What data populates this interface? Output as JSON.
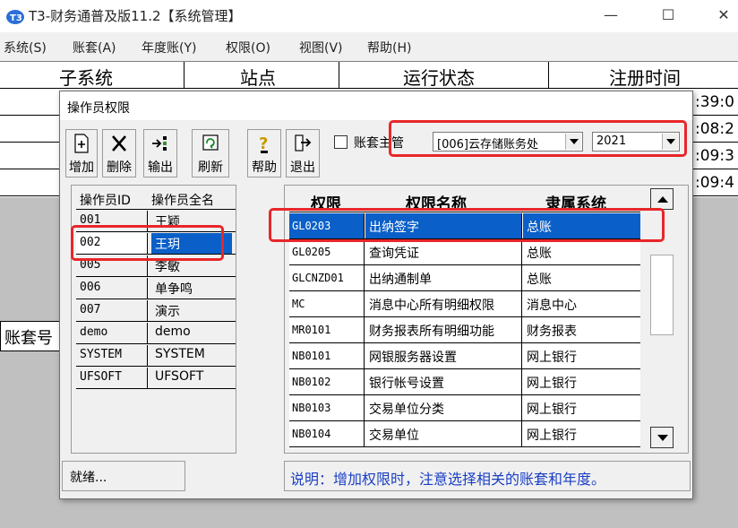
{
  "window": {
    "title": "T3-财务通普及版11.2【系统管理】",
    "minimize": "—",
    "maximize": "☐",
    "close": "✕"
  },
  "menu": [
    "系统(S)",
    "账套(A)",
    "年度账(Y)",
    "权限(O)",
    "视图(V)",
    "帮助(H)"
  ],
  "main_table": {
    "columns": [
      "子系统",
      "站点",
      "运行状态",
      "注册时间"
    ],
    "times": [
      ":39:0",
      ":08:2",
      ":09:3",
      ":09:4"
    ],
    "lower_label": "账套号"
  },
  "dialog": {
    "title": "操作员权限",
    "toolbar": [
      "增加",
      "删除",
      "输出",
      "刷新",
      "帮助",
      "退出"
    ],
    "supervisor_label": "账套主管",
    "account_combo": "[006]云存储账务处",
    "year_combo": "2021",
    "operator_columns": [
      "操作员ID",
      "操作员全名"
    ],
    "operators": [
      {
        "id": "001",
        "name": "王颖"
      },
      {
        "id": "002",
        "name": "王玥"
      },
      {
        "id": "005",
        "name": "李敏"
      },
      {
        "id": "006",
        "name": "单争鸣"
      },
      {
        "id": "007",
        "name": "演示"
      },
      {
        "id": "demo",
        "name": "demo"
      },
      {
        "id": "SYSTEM",
        "name": "SYSTEM"
      },
      {
        "id": "UFSOFT",
        "name": "UFSOFT"
      }
    ],
    "selected_operator": "002",
    "perm_columns": [
      "权限",
      "权限名称",
      "隶属系统"
    ],
    "permissions": [
      {
        "code": "GL0203",
        "name": "出纳签字",
        "system": "总账"
      },
      {
        "code": "GL0205",
        "name": "查询凭证",
        "system": "总账"
      },
      {
        "code": "GLCNZD01",
        "name": "出纳通制单",
        "system": "总账"
      },
      {
        "code": "MC",
        "name": "消息中心所有明细权限",
        "system": "消息中心"
      },
      {
        "code": "MR0101",
        "name": "财务报表所有明细功能",
        "system": "财务报表"
      },
      {
        "code": "NB0101",
        "name": "网银服务器设置",
        "system": "网上银行"
      },
      {
        "code": "NB0102",
        "name": "银行帐号设置",
        "system": "网上银行"
      },
      {
        "code": "NB0103",
        "name": "交易单位分类",
        "system": "网上银行"
      },
      {
        "code": "NB0104",
        "name": "交易单位",
        "system": "网上银行"
      }
    ],
    "selected_permission": "GL0203",
    "status": "就绪...",
    "note": "说明：增加权限时，注意选择相关的账套和年度。"
  },
  "colors": {
    "selection": "#0a5fc8",
    "annotation_red": "#e8262a",
    "note_blue": "#1a3fc4"
  }
}
